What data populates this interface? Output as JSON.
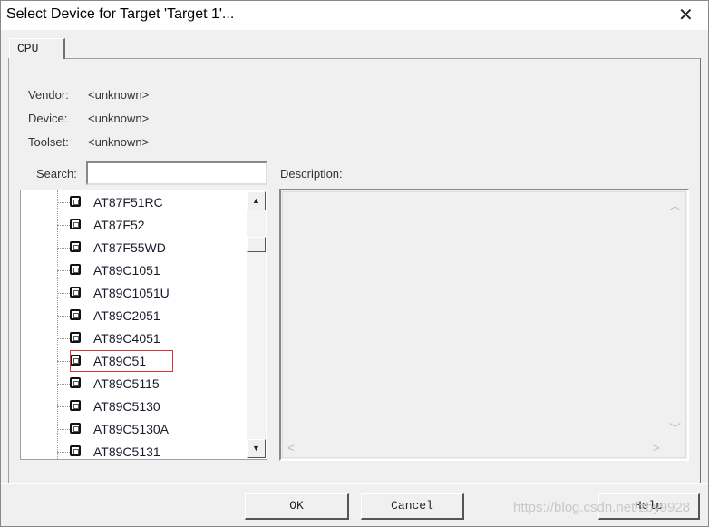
{
  "window": {
    "title": "Select Device for Target 'Target 1'...",
    "close_icon": "close-icon"
  },
  "tabs": [
    {
      "label": "CPU",
      "active": true
    }
  ],
  "info": {
    "vendor_label": "Vendor:",
    "vendor_value": "<unknown>",
    "device_label": "Device:",
    "device_value": "<unknown>",
    "toolset_label": "Toolset:",
    "toolset_value": "<unknown>"
  },
  "search": {
    "label": "Search:",
    "value": ""
  },
  "description": {
    "label": "Description:"
  },
  "devices": [
    "AT87F51RC",
    "AT87F52",
    "AT87F55WD",
    "AT89C1051",
    "AT89C1051U",
    "AT89C2051",
    "AT89C4051",
    "AT89C51",
    "AT89C5115",
    "AT89C5130",
    "AT89C5130A",
    "AT89C5131"
  ],
  "selected_device": "AT89C51",
  "colors": {
    "selection_border": "#e03030"
  },
  "buttons": {
    "ok": "OK",
    "cancel": "Cancel",
    "help": "Help"
  },
  "watermark": "https://blog.csdn.net/zby9928"
}
